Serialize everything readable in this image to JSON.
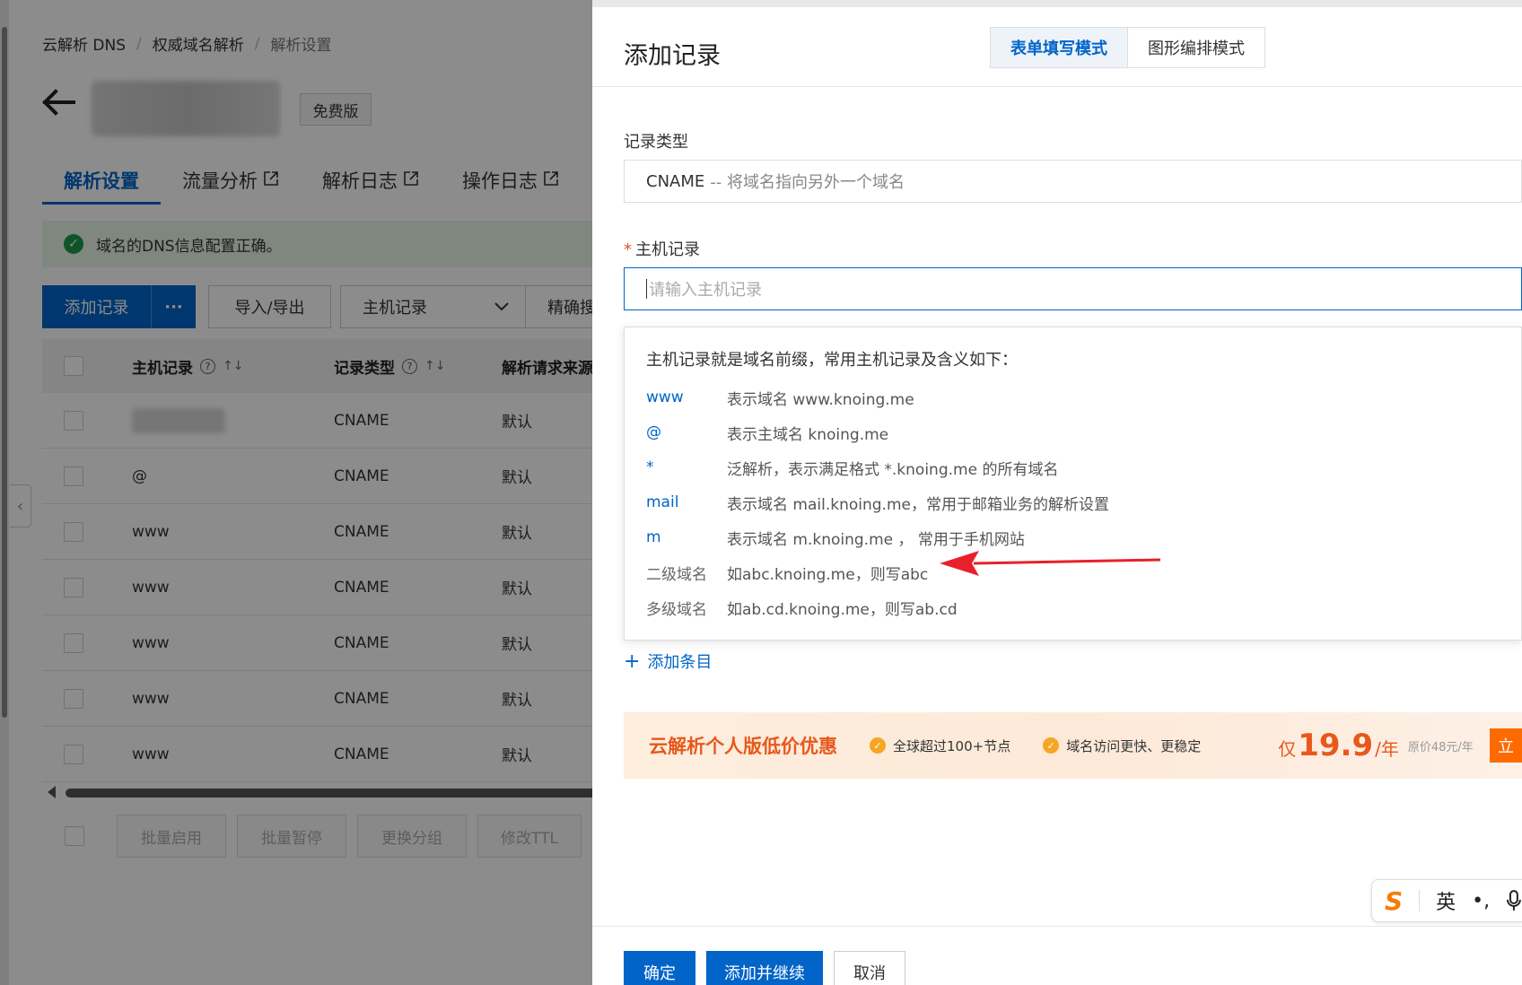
{
  "breadcrumb": {
    "items": [
      "云解析 DNS",
      "权威域名解析",
      "解析设置"
    ]
  },
  "domain": {
    "plan_badge": "免费版"
  },
  "tabs": [
    {
      "label": "解析设置"
    },
    {
      "label": "流量分析"
    },
    {
      "label": "解析日志"
    },
    {
      "label": "操作日志"
    }
  ],
  "alert": {
    "text": "域名的DNS信息配置正确。"
  },
  "toolbar": {
    "add_record": "添加记录",
    "more": "···",
    "import_export": "导入/导出",
    "filter_select": "主机记录",
    "exact_search": "精确搜"
  },
  "table": {
    "headers": {
      "host": "主机记录",
      "type": "记录类型",
      "source": "解析请求来源"
    },
    "rows": [
      {
        "host": "",
        "type": "CNAME",
        "source": "默认"
      },
      {
        "host": "@",
        "type": "CNAME",
        "source": "默认"
      },
      {
        "host": "www",
        "type": "CNAME",
        "source": "默认"
      },
      {
        "host": "www",
        "type": "CNAME",
        "source": "默认"
      },
      {
        "host": "www",
        "type": "CNAME",
        "source": "默认"
      },
      {
        "host": "www",
        "type": "CNAME",
        "source": "默认"
      },
      {
        "host": "www",
        "type": "CNAME",
        "source": "默认"
      }
    ]
  },
  "bulk_actions": {
    "enable": "批量启用",
    "pause": "批量暂停",
    "change_group": "更换分组",
    "modify_ttl": "修改TTL"
  },
  "drawer": {
    "title": "添加记录",
    "mode_form": "表单填写模式",
    "mode_graphic": "图形编排模式",
    "record_type_label": "记录类型",
    "record_type_value": "CNAME",
    "record_type_desc": "-- 将域名指向另外一个域名",
    "host_label": "主机记录",
    "host_required": "*",
    "host_placeholder": "请输入主机记录",
    "tip": {
      "heading": "主机记录就是域名前缀，常用主机记录及含义如下：",
      "rows": [
        {
          "key": "www",
          "desc": "表示域名 www.knoing.me"
        },
        {
          "key": "@",
          "desc": "表示主域名 knoing.me"
        },
        {
          "key": "*",
          "desc": "泛解析，表示满足格式 *.knoing.me 的所有域名"
        },
        {
          "key": "mail",
          "desc": "表示域名 mail.knoing.me，常用于邮箱业务的解析设置"
        },
        {
          "key": "m",
          "desc": "表示域名 m.knoing.me ， 常用于手机网站"
        },
        {
          "key": "二级域名",
          "desc": "如abc.knoing.me，则写abc"
        },
        {
          "key": "多级域名",
          "desc": "如ab.cd.knoing.me，则写ab.cd"
        }
      ]
    },
    "add_item": "添加条目",
    "promo": {
      "title": "云解析个人版低价优惠",
      "feature1": "全球超过100+节点",
      "feature2": "域名访问更快、更稳定",
      "price_prefix": "仅",
      "price_value": "19.9",
      "price_unit": "/年",
      "original_price": "原价48元/年",
      "cta": "立"
    },
    "footer": {
      "confirm": "确定",
      "add_continue": "添加并继续",
      "cancel": "取消"
    }
  },
  "ime": {
    "lang": "英",
    "punct": "•,"
  },
  "colors": {
    "primary": "#0064c8",
    "promo_orange": "#e8581c",
    "arrow_red": "#e8202a"
  }
}
